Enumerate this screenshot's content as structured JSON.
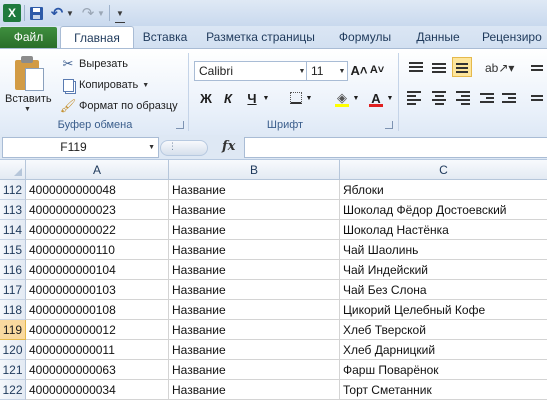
{
  "app": {
    "logo": "X"
  },
  "tabs": {
    "file": "Файл",
    "home": "Главная",
    "insert": "Вставка",
    "page_layout": "Разметка страницы",
    "formulas": "Формулы",
    "data": "Данные",
    "review": "Рецензиро"
  },
  "ribbon": {
    "clipboard": {
      "paste": "Вставить",
      "cut": "Вырезать",
      "copy": "Копировать",
      "format_painter": "Формат по образцу",
      "label": "Буфер обмена"
    },
    "font": {
      "name": "Calibri",
      "size": "11",
      "bold": "Ж",
      "italic": "К",
      "underline": "Ч",
      "font_color_glyph": "A",
      "grow_glyph": "A˄",
      "shrink_glyph": "A˅",
      "label": "Шрифт",
      "fill_color": "#ffff00",
      "font_color": "#e02020"
    }
  },
  "formula_bar": {
    "name_box": "F119",
    "fx": "fx",
    "value": ""
  },
  "columns": [
    "A",
    "B",
    "C"
  ],
  "active_row": "119",
  "rows": [
    {
      "num": "112",
      "a": "4000000000048",
      "b": "Название",
      "c": "Яблоки"
    },
    {
      "num": "113",
      "a": "4000000000023",
      "b": "Название",
      "c": "Шоколад Фёдор Достоевский"
    },
    {
      "num": "114",
      "a": "4000000000022",
      "b": "Название",
      "c": "Шоколад Настёнка"
    },
    {
      "num": "115",
      "a": "4000000000110",
      "b": "Название",
      "c": "Чай Шаолинь"
    },
    {
      "num": "116",
      "a": "4000000000104",
      "b": "Название",
      "c": "Чай Индейский"
    },
    {
      "num": "117",
      "a": "4000000000103",
      "b": "Название",
      "c": "Чай Без Слона"
    },
    {
      "num": "118",
      "a": "4000000000108",
      "b": "Название",
      "c": "Цикорий Целебный Кофе"
    },
    {
      "num": "119",
      "a": "4000000000012",
      "b": "Название",
      "c": "Хлеб Тверской"
    },
    {
      "num": "120",
      "a": "4000000000011",
      "b": "Название",
      "c": "Хлеб Дарницкий"
    },
    {
      "num": "121",
      "a": "4000000000063",
      "b": "Название",
      "c": "Фарш Поварёнок"
    },
    {
      "num": "122",
      "a": "4000000000034",
      "b": "Название",
      "c": "Торт Сметанник"
    }
  ]
}
